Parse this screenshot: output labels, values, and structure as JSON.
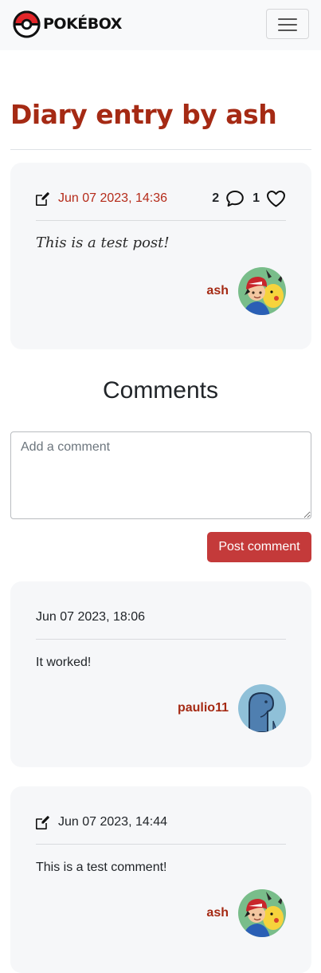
{
  "navbar": {
    "brand": "POKÉBOX",
    "menu_toggle_label": "Toggle navigation"
  },
  "title": "Diary entry by ash",
  "post": {
    "date": "Jun 07 2023, 14:36",
    "comment_count": "2",
    "like_count": "1",
    "text": "This is a test post!",
    "author": "ash"
  },
  "comments_heading": "Comments",
  "comment_form": {
    "placeholder": "Add a comment",
    "submit_label": "Post comment"
  },
  "comments": [
    {
      "date": "Jun 07 2023, 18:06",
      "text": "It worked!",
      "author": "paulio11"
    },
    {
      "date": "Jun 07 2023, 14:44",
      "text": "This is a test comment!",
      "author": "ash"
    }
  ],
  "colors": {
    "accent": "#a52a14",
    "button": "#c43a3a",
    "card": "#f6f7f9"
  }
}
